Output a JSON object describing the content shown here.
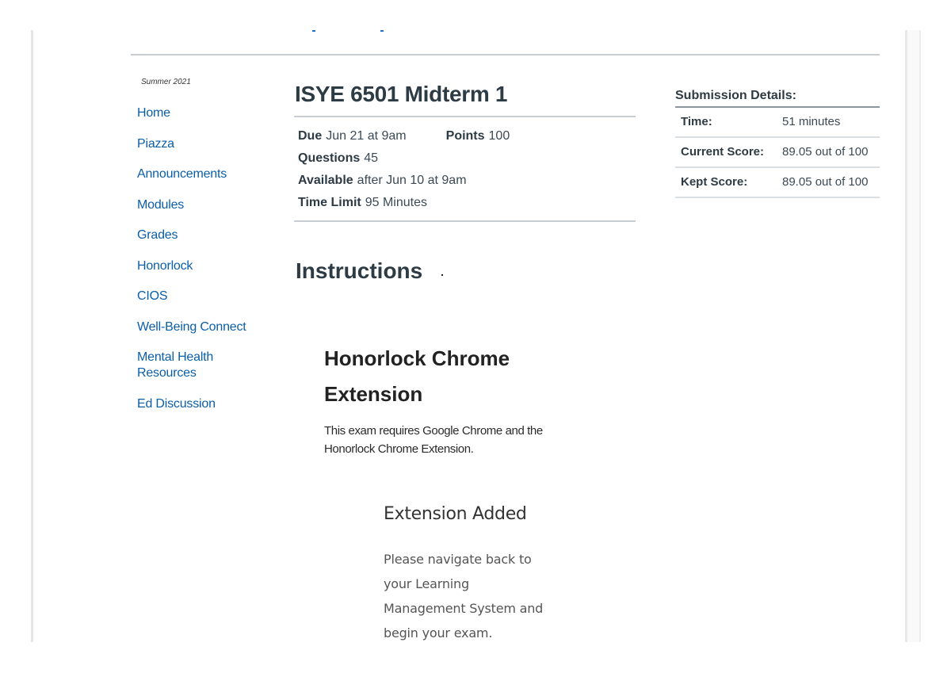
{
  "course": {
    "term": "Summer 2021"
  },
  "sidebar": {
    "items": [
      {
        "label": "Home"
      },
      {
        "label": "Piazza"
      },
      {
        "label": "Announcements"
      },
      {
        "label": "Modules"
      },
      {
        "label": "Grades"
      },
      {
        "label": "Honorlock"
      },
      {
        "label": "CIOS"
      },
      {
        "label": "Well-Being Connect"
      },
      {
        "label": "Mental Health Resources"
      },
      {
        "label": "Ed Discussion"
      }
    ]
  },
  "quiz": {
    "title": "ISYE 6501 Midterm 1",
    "due_label": "Due",
    "due_value": "Jun 21 at 9am",
    "points_label": "Points",
    "points_value": "100",
    "questions_label": "Questions",
    "questions_value": "45",
    "available_label": "Available",
    "available_value": "after Jun 10 at 9am",
    "time_limit_label": "Time Limit",
    "time_limit_value": "95 Minutes"
  },
  "instructions": {
    "heading": "Instructions",
    "extension_title": "Honorlock Chrome Extension",
    "extension_desc": "This exam requires Google Chrome and the Honorlock Chrome Extension.",
    "added_title": "Extension Added",
    "added_message": "Please navigate back to your Learning Management System and begin your exam."
  },
  "submission": {
    "title": "Submission Details:",
    "rows": [
      {
        "label": "Time:",
        "value": "51 minutes"
      },
      {
        "label": "Current Score:",
        "value": "89.05 out of 100"
      },
      {
        "label": "Kept Score:",
        "value": "89.05 out of 100"
      }
    ]
  },
  "colors": {
    "link": "#0b5ea8",
    "heading": "#2d3b45"
  }
}
